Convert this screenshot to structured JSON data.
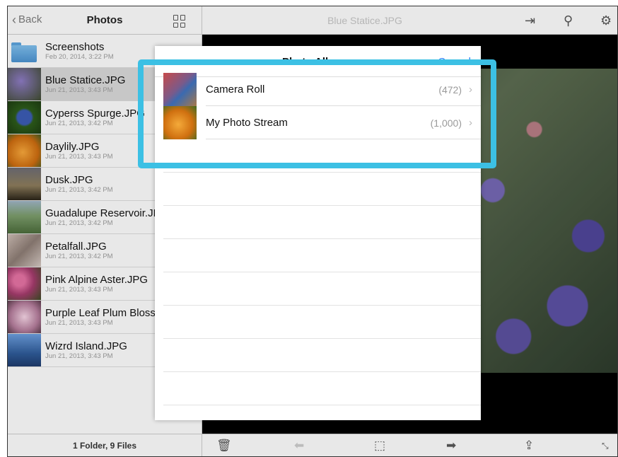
{
  "sidebar": {
    "back_label": "Back",
    "title": "Photos",
    "footer": "1 Folder, 9 Files",
    "files": [
      {
        "name": "Screenshots",
        "date": "Feb 20, 2014, 3:22 PM",
        "thumb": "folder-icon"
      },
      {
        "name": "Blue Statice.JPG",
        "date": "Jun 21, 2013, 3:43 PM",
        "thumb": "#6b5a9e"
      },
      {
        "name": "Cyperss Spurge.JPG",
        "date": "Jun 21, 2013, 3:42 PM",
        "thumb": "#4a7a2a"
      },
      {
        "name": "Daylily.JPG",
        "date": "Jun 21, 2013, 3:43 PM",
        "thumb": "#e08a1c"
      },
      {
        "name": "Dusk.JPG",
        "date": "Jun 21, 2013, 3:42 PM",
        "thumb": "#4b4a3c"
      },
      {
        "name": "Guadalupe Reservoir.JPG",
        "date": "Jun 21, 2013, 3:42 PM",
        "thumb": "#6d8a5a"
      },
      {
        "name": "Petalfall.JPG",
        "date": "Jun 21, 2013, 3:42 PM",
        "thumb": "#a89890"
      },
      {
        "name": "Pink Alpine Aster.JPG",
        "date": "Jun 21, 2013, 3:43 PM",
        "thumb": "#c0568a"
      },
      {
        "name": "Purple Leaf Plum Blossom.JPG",
        "date": "Jun 21, 2013, 3:43 PM",
        "thumb": "#c9a0b8"
      },
      {
        "name": "Wizrd Island.JPG",
        "date": "Jun 21, 2013, 3:43 PM",
        "thumb": "#3f6ea8"
      }
    ]
  },
  "main": {
    "title": "Blue Statice.JPG",
    "header_icons": [
      "open-in-icon",
      "wifi-transfer-icon",
      "gear-icon"
    ],
    "footer_icons": [
      "trash-icon",
      "arrow-left-icon",
      "mouse-icon",
      "arrow-right-icon",
      "share-icon",
      "fullscreen-icon"
    ]
  },
  "popover": {
    "title": "Photo Albums",
    "cancel_label": "Cancel",
    "albums": [
      {
        "name": "Camera Roll",
        "count": "(472)",
        "thumb": "#b64646"
      },
      {
        "name": "My Photo Stream",
        "count": "(1,000)",
        "thumb": "#e89322"
      }
    ]
  },
  "colors": {
    "highlight": "#3cc0e4",
    "accent_blue": "#2a7ff7"
  }
}
